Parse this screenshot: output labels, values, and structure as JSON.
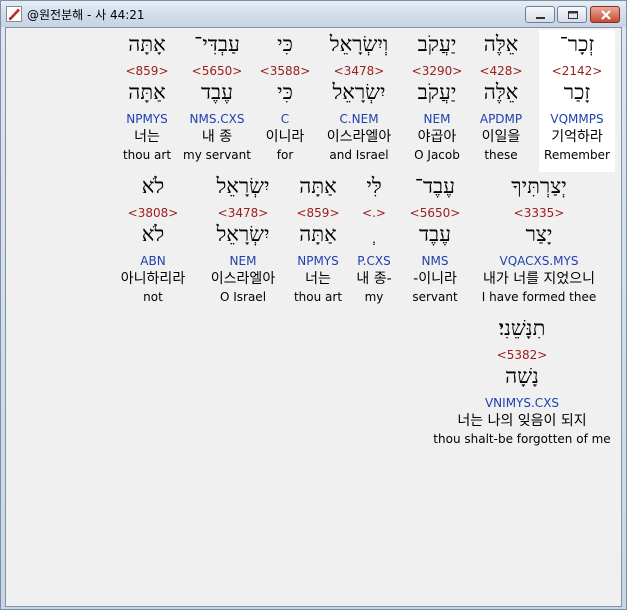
{
  "window": {
    "title": "@원전분해 - 사 44:21",
    "icon": "pen-icon"
  },
  "verse": {
    "line1": [
      {
        "heb": "זְכָר־",
        "strong": "<2142>",
        "lemma": "זָכַר",
        "morph": "VQMMPS",
        "kor": "기억하라",
        "eng": "Remember"
      },
      {
        "heb": "אֵלֶּה",
        "strong": "<428>",
        "lemma": "אֵלֶּה",
        "morph": "APDMP",
        "kor": "이일을",
        "eng": "these"
      },
      {
        "heb": "יַעֲקֹב",
        "strong": "<3290>",
        "lemma": "יַעֲקֹב",
        "morph": "NEM",
        "kor": "야곱아",
        "eng": "O Jacob"
      },
      {
        "heb": "וְיִשְׂרָאֵל",
        "strong": "<3478>",
        "lemma": "יִשְׂרָאֵל",
        "morph": "C.NEM",
        "kor": "이스라엘아",
        "eng": "and Israel"
      },
      {
        "heb": "כִּי",
        "strong": "<3588>",
        "lemma": "כִּי",
        "morph": "C",
        "kor": "이니라",
        "eng": "for"
      },
      {
        "heb": "עַבְדִּי־",
        "strong": "<5650>",
        "lemma": "עֶבֶד",
        "morph": "NMS.CXS",
        "kor": "내 종",
        "eng": "my servant"
      },
      {
        "heb": "אָתָּה",
        "strong": "<859>",
        "lemma": "אַתָּה",
        "morph": "NPMYS",
        "kor": "너는",
        "eng": "thou art"
      }
    ],
    "line2": [
      {
        "heb": "יְצַרְתִּיךָ",
        "strong": "<3335>",
        "lemma": "יָצַר",
        "morph": "VQACXS.MYS",
        "kor": "내가 너를 지었으니",
        "eng": "I have formed thee"
      },
      {
        "heb": "עֶבֶד־",
        "strong": "<5650>",
        "lemma": "עֶבֶד",
        "morph": "NMS",
        "kor": "-이니라",
        "eng": "servant"
      },
      {
        "heb": "לִּי",
        "strong": "<.>",
        "lemma": "ְ",
        "morph": "P.CXS",
        "kor": "내 종-",
        "eng": "my"
      },
      {
        "heb": "אַתָּה",
        "strong": "<859>",
        "lemma": "אַתָּה",
        "morph": "NPMYS",
        "kor": "너는",
        "eng": "thou art"
      },
      {
        "heb": "יִשְׂרָאֵל",
        "strong": "<3478>",
        "lemma": "יִשְׂרָאֵל",
        "morph": "NEM",
        "kor": "이스라엘아",
        "eng": "O Israel"
      },
      {
        "heb": "לֹא",
        "strong": "<3808>",
        "lemma": "לֹא",
        "morph": "ABN",
        "kor": "아니하리라",
        "eng": "not"
      }
    ],
    "line3": [
      {
        "heb": "תִנָּשֵׁנִי׃",
        "strong": "<5382>",
        "lemma": "נָשָׁה",
        "morph": "VNIMYS.CXS",
        "kor": "너는 나의 잊음이 되지",
        "eng": "thou shalt-be forgotten of me"
      }
    ]
  },
  "colors": {
    "strong": "#9b1c1c",
    "morph": "#1f3fb0",
    "highlight": "#ffffff"
  }
}
